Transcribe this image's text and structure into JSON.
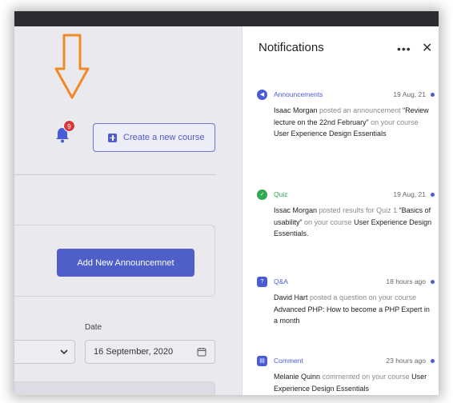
{
  "header": {
    "notification_count": "9",
    "create_course_label": "Create a new course"
  },
  "announcements": {
    "add_button_label": "Add New Announcemnet"
  },
  "filters": {
    "date_label": "Date",
    "date_value": "16 September, 2020"
  },
  "panel": {
    "title": "Notifications",
    "more_label": "•••",
    "close_label": "✕",
    "items": [
      {
        "type": "Announcements",
        "time": "19 Aug, 21",
        "color": "#4a5bd6",
        "icon": "megaphone-icon",
        "actor": "Isaac Morgan",
        "verb": "posted an announcement",
        "object": "“Review lecture on the 22nd February”",
        "prep": "on your course",
        "course": "User Experience Design Essentials"
      },
      {
        "type": "Quiz",
        "time": "19 Aug, 21",
        "color": "#2fa84f",
        "icon": "quiz-icon",
        "actor": "Issac Morgan",
        "verb": "posted results for Quiz 1",
        "object": "“Basics of usability”",
        "prep": "on your course",
        "course": "User Experience Design Essentials."
      },
      {
        "type": "Q&A",
        "time": "18 hours ago",
        "color": "#4a5bd6",
        "icon": "qa-icon",
        "actor": "David Hart",
        "verb": "posted a question on your course",
        "object": "",
        "prep": "",
        "course": "Advanced PHP: How to become a PHP Expert in a month"
      },
      {
        "type": "Comment",
        "time": "23 hours ago",
        "color": "#4a5bd6",
        "icon": "comment-icon",
        "actor": "Melanie Quinn",
        "verb": "commented on your course",
        "object": "",
        "prep": "",
        "course": "User Experience Design Essentials"
      }
    ]
  },
  "colors": {
    "accent": "#4e5fc9",
    "arrow": "#f08a28",
    "badge": "#d8363a"
  }
}
